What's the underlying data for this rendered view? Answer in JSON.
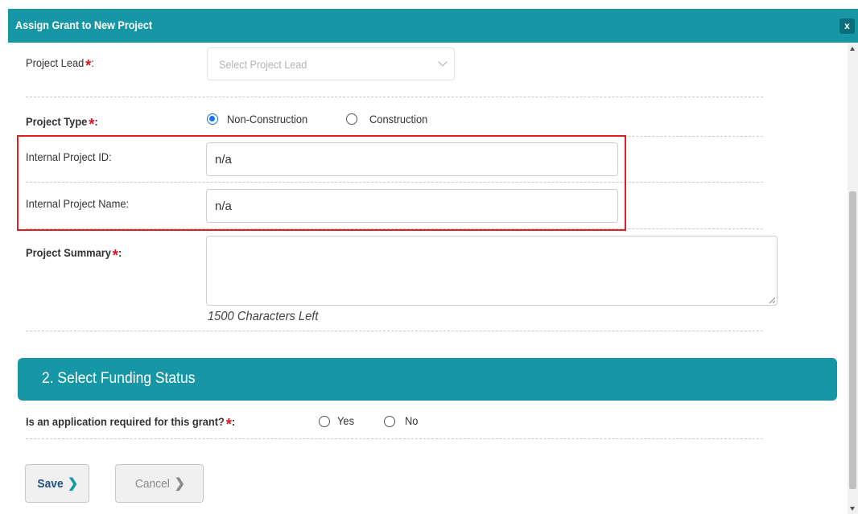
{
  "modal": {
    "title": "Assign Grant to New Project",
    "close_label": "x"
  },
  "form": {
    "project_lead": {
      "label": "Project Lead",
      "colon": ":",
      "placeholder": "Select Project Lead"
    },
    "project_type": {
      "label": "Project Type",
      "colon": ":",
      "options": [
        "Non-Construction",
        "Construction"
      ],
      "selected": "Non-Construction"
    },
    "internal_project_id": {
      "label": "Internal Project ID:",
      "value": "n/a"
    },
    "internal_project_name": {
      "label": "Internal Project Name:",
      "value": "n/a"
    },
    "project_summary": {
      "label": "Project Summary",
      "colon": ":",
      "value": "",
      "chars_left": "1500 Characters Left"
    }
  },
  "funding": {
    "section_title": "2. Select Funding Status",
    "question": "Is an application required for this grant?",
    "colon": ":",
    "options": [
      "Yes",
      "No"
    ]
  },
  "required_marker": "*",
  "buttons": {
    "save": "Save",
    "cancel": "Cancel",
    "chevron": "❯"
  },
  "colors": {
    "accent": "#1797a6",
    "highlight": "#e02020",
    "required": "#e0161f",
    "radio_checked": "#1a73e8"
  }
}
